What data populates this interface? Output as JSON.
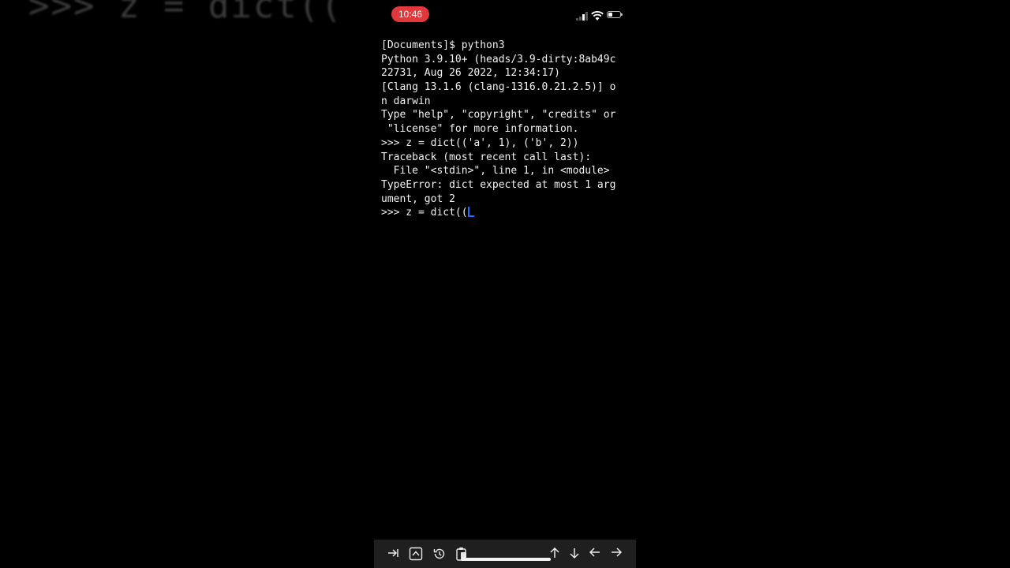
{
  "background": {
    "zoomed_text": ">>> z = dict(("
  },
  "status_bar": {
    "time": "10:46",
    "time_pill_color": "#e1393b"
  },
  "terminal": {
    "lines": [
      "[Documents]$ python3",
      "Python 3.9.10+ (heads/3.9-dirty:8ab49c",
      "22731, Aug 26 2022, 12:34:17)",
      "[Clang 13.1.6 (clang-1316.0.21.2.5)] o",
      "n darwin",
      "Type \"help\", \"copyright\", \"credits\" or",
      " \"license\" for more information.",
      ">>> z = dict(('a', 1), ('b', 2))",
      "Traceback (most recent call last):",
      "  File \"<stdin>\", line 1, in <module>",
      "TypeError: dict expected at most 1 arg",
      "ument, got 2"
    ],
    "input_line": ">>> z = dict((",
    "cursor_color": "#1e6bff"
  },
  "toolbar": {
    "icons": [
      "tab-icon",
      "control-key-icon",
      "history-icon",
      "paste-icon",
      "arrow-up-icon",
      "arrow-down-icon",
      "arrow-left-icon",
      "arrow-right-icon"
    ]
  }
}
